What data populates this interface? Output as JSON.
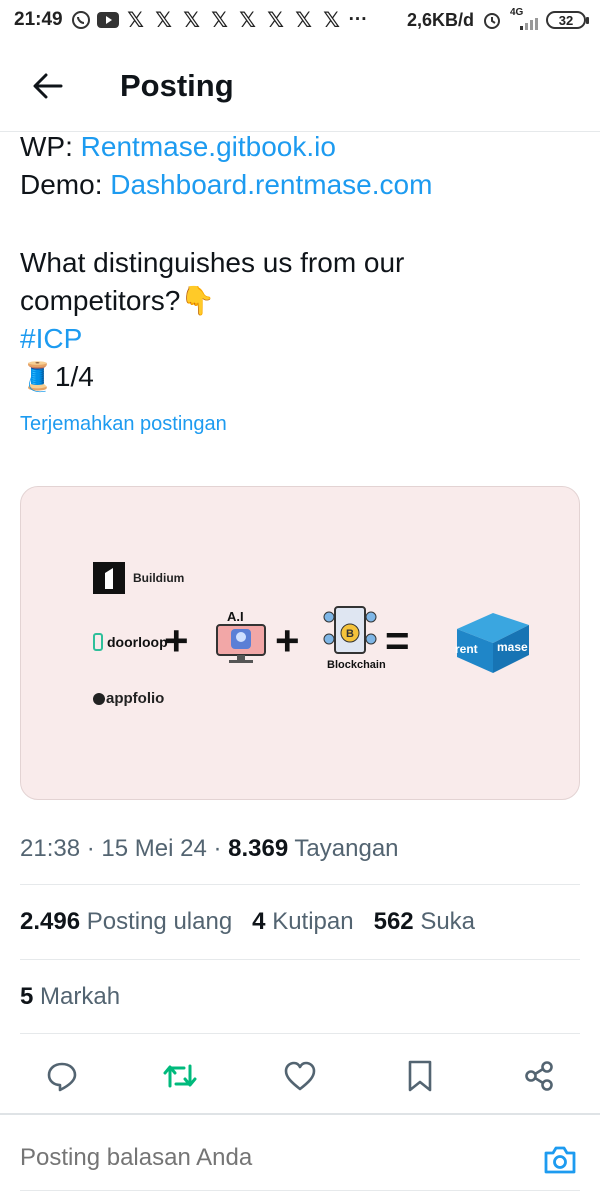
{
  "status_bar": {
    "time": "21:49",
    "network_speed": "2,6KB/d",
    "network_type": "4G",
    "battery": "32",
    "more_indicator": "···",
    "notification_icons": [
      "whatsapp-icon",
      "youtube-icon",
      "x-icon",
      "x-icon",
      "x-icon",
      "x-icon",
      "x-icon",
      "x-icon",
      "x-icon",
      "x-icon"
    ]
  },
  "header": {
    "title": "Posting"
  },
  "post": {
    "wp_label": "WP: ",
    "wp_link": "Rentmase.gitbook.io",
    "demo_label": "Demo: ",
    "demo_link": "Dashboard.rentmase.com",
    "question_line1": "What distinguishes us from our",
    "question_line2": "competitors?",
    "question_emoji": "👇",
    "hashtag": "#ICP",
    "thread_emoji": "🧵",
    "thread_count": "1/4",
    "translate": "Terjemahkan postingan"
  },
  "media": {
    "buildium": "Buildium",
    "doorloop": "doorloop",
    "appfolio": "appfolio",
    "ai_label": "A.I",
    "blockchain": "Blockchain",
    "plus": "+",
    "equals": "=",
    "rentmase_rent": "rent",
    "rentmase_mase": "mase",
    "background": "#f9ebeb"
  },
  "meta": {
    "time": "21:38",
    "sep1": " · ",
    "date": "15 Mei 24",
    "sep2": " · ",
    "views_count": "8.369",
    "views_label": " Tayangan"
  },
  "stats": {
    "reposts_count": "2.496",
    "reposts_label": " Posting ulang",
    "quotes_count": "4",
    "quotes_label": " Kutipan",
    "likes_count": "562",
    "likes_label": " Suka",
    "bookmarks_count": "5",
    "bookmarks_label": " Markah"
  },
  "reply": {
    "placeholder": "Posting balasan Anda"
  },
  "colors": {
    "accent": "#1d9bf0",
    "repost_green": "#00ba7c",
    "text_primary": "#0f1419",
    "text_secondary": "#536471"
  }
}
